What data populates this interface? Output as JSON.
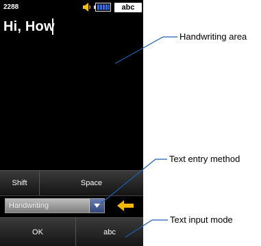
{
  "status_bar": {
    "time": "2288",
    "volume_icon": "speaker-icon",
    "battery_icon": "battery-icon",
    "input_mode_indicator": "abc"
  },
  "text_field": {
    "value": "Hi, How"
  },
  "keyboard": {
    "shift_label": "Shift",
    "space_label": "Space",
    "entry_method_value": "Handwriting",
    "dropdown_icon": "chevron-down-icon",
    "backspace_icon": "arrow-left-icon",
    "ok_label": "OK",
    "mode_label": "abc"
  },
  "callouts": {
    "handwriting_area": "Handwriting area",
    "text_entry_method": "Text entry method",
    "text_input_mode": "Text input mode"
  },
  "colors": {
    "background": "#000000",
    "accent_arrow": "#f2b705",
    "dropdown_button": "#4a5f95"
  }
}
